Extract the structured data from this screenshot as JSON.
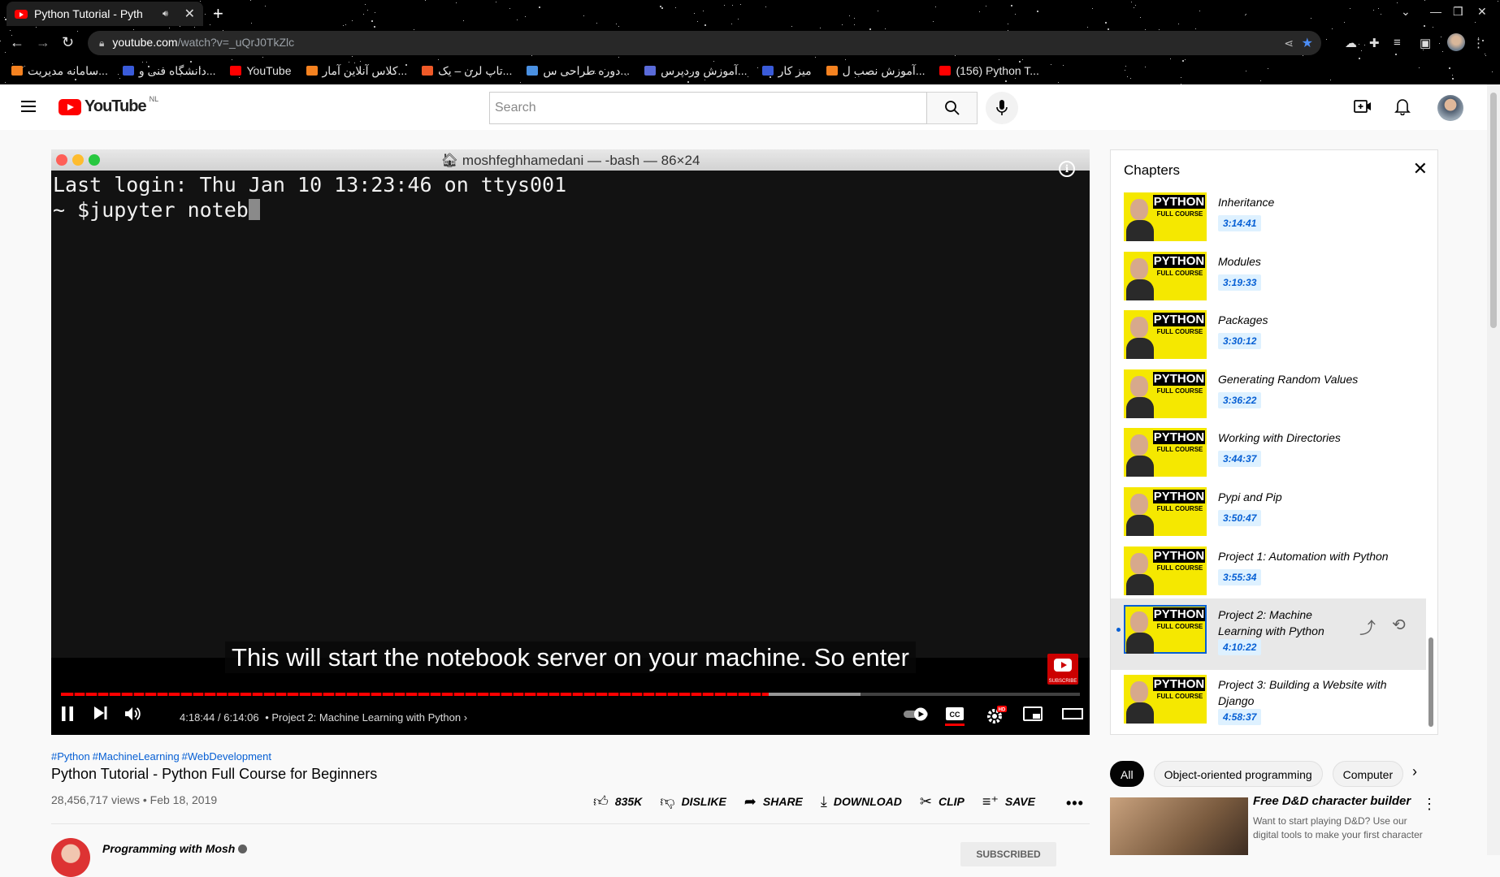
{
  "browser": {
    "tab_title": "Python Tutorial - Pyth",
    "new_tab_label": "+",
    "url_host": "youtube.com",
    "url_path": "/watch?v=_uQrJ0TkZlc",
    "bookmarks": [
      {
        "label": "سامانه مدیریت...",
        "color": "#f58220"
      },
      {
        "label": "دانشگاه فنی و...",
        "color": "#3a5bd9"
      },
      {
        "label": "YouTube",
        "color": "#ff0000"
      },
      {
        "label": "کلاس آنلاین آمار...",
        "color": "#f58220"
      },
      {
        "label": "تاپ لرن – یک...",
        "color": "#f05a28"
      },
      {
        "label": "دوره طراحی س...",
        "color": "#4a90e2"
      },
      {
        "label": "آموزش وردپرس...",
        "color": "#5a6bd9"
      },
      {
        "label": "میز کار",
        "color": "#3a5bd9"
      },
      {
        "label": "آموزش نصب ل...",
        "color": "#f58220"
      },
      {
        "label": "(156) Python T...",
        "color": "#ff0000"
      }
    ]
  },
  "header": {
    "logo_text": "YouTube",
    "country_code": "NL",
    "search_placeholder": "Search"
  },
  "player": {
    "terminal_title": "moshfeghhamedani — -bash — 86×24",
    "terminal_lines": [
      "Last login: Thu Jan 10 13:23:46 on ttys001",
      "~ $jupyter noteb"
    ],
    "caption": "This will start the notebook server on your machine. So enter",
    "watermark_text": "SUBSCRIBE",
    "time": "4:18:44 / 6:14:06",
    "chapter_label": "• Project 2: Machine Learning with Python",
    "progress_fraction": 0.6945
  },
  "video": {
    "hashtags": [
      "#Python",
      "#MachineLearning",
      "#WebDevelopment"
    ],
    "title": "Python Tutorial - Python Full Course for Beginners",
    "views_date": "28,456,717 views • Feb 18, 2019",
    "actions": {
      "like": "835K",
      "dislike": "DISLIKE",
      "share": "SHARE",
      "download": "DOWNLOAD",
      "clip": "CLIP",
      "save": "SAVE"
    },
    "channel_name": "Programming with Mosh",
    "subscribed_label": "SUBSCRIBED"
  },
  "chapters": {
    "heading": "Chapters",
    "thumb_big": "PYTHON",
    "thumb_small": "FULL COURSE",
    "items": [
      {
        "title": "Inheritance",
        "time": "3:14:41"
      },
      {
        "title": "Modules",
        "time": "3:19:33"
      },
      {
        "title": "Packages",
        "time": "3:30:12"
      },
      {
        "title": "Generating Random Values",
        "time": "3:36:22"
      },
      {
        "title": "Working with Directories",
        "time": "3:44:37"
      },
      {
        "title": "Pypi and Pip",
        "time": "3:50:47"
      },
      {
        "title": "Project 1: Automation with Python",
        "time": "3:55:34"
      },
      {
        "title": "Project 2: Machine Learning with Python",
        "time": "4:10:22",
        "active": true
      },
      {
        "title": "Project 3: Building a Website with Django",
        "time": "4:58:37"
      }
    ]
  },
  "chips": [
    "All",
    "Object-oriented programming",
    "Computer"
  ],
  "recommended": {
    "title": "Free D&D character builder",
    "description": "Want to start playing D&D? Use our digital tools to make your first character"
  }
}
